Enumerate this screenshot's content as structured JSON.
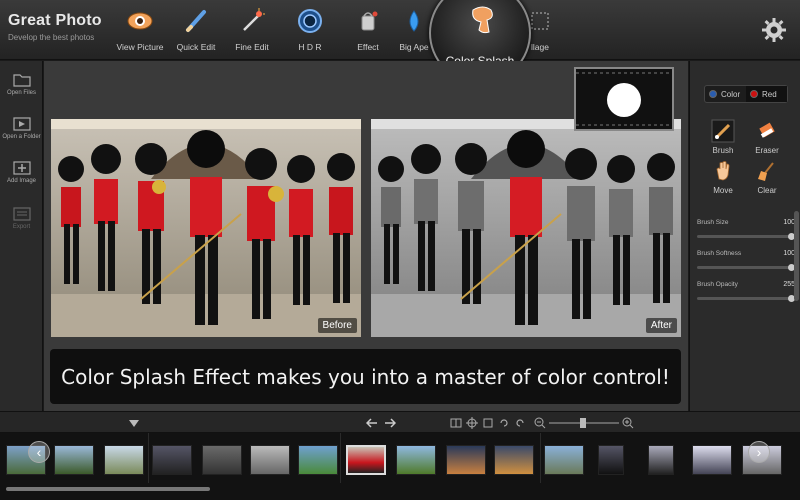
{
  "app": {
    "title": "Great Photo",
    "subtitle": "Develop the best photos"
  },
  "toolbar": {
    "items": [
      {
        "label": "View Picture",
        "icon": "eye-icon"
      },
      {
        "label": "Quick Edit",
        "icon": "pencil-icon"
      },
      {
        "label": "Fine Edit",
        "icon": "magic-wand-icon"
      },
      {
        "label": "H D R",
        "icon": "hdr-icon"
      },
      {
        "label": "Effect",
        "icon": "paint-bucket-icon"
      },
      {
        "label": "Big Aperture",
        "icon": "drop-icon"
      },
      {
        "label": "Color Splash",
        "icon": "color-splash-icon",
        "active": true
      },
      {
        "label": "Collage",
        "icon": "collage-icon"
      }
    ],
    "active_label": "Color Splash",
    "big_aperture_visible": "Big Ape",
    "collage_visible": "llage"
  },
  "sidebar": {
    "items": [
      {
        "label": "Open Files",
        "icon": "folder-icon"
      },
      {
        "label": "Open a Folder",
        "icon": "folder-open-icon"
      },
      {
        "label": "Add Image",
        "icon": "add-image-icon"
      },
      {
        "label": "Export",
        "icon": "export-icon",
        "disabled": true
      }
    ]
  },
  "canvas": {
    "before_label": "Before",
    "after_label": "After",
    "caption": "Color Splash Effect makes you into a master of color control!"
  },
  "right_panel": {
    "mode_options": [
      {
        "label": "Color",
        "color": "#2a5db0"
      },
      {
        "label": "Red",
        "color": "#cc1111",
        "selected": true
      }
    ],
    "tools": [
      {
        "label": "Brush",
        "icon": "brush-icon"
      },
      {
        "label": "Eraser",
        "icon": "eraser-icon"
      },
      {
        "label": "Move",
        "icon": "hand-icon"
      },
      {
        "label": "Clear",
        "icon": "broom-icon"
      }
    ],
    "sliders": [
      {
        "label": "Brush Size",
        "value": "100",
        "fraction": 1.0
      },
      {
        "label": "Brush Softness",
        "value": "100",
        "fraction": 1.0
      },
      {
        "label": "Brush Opacity",
        "value": "255",
        "fraction": 1.0
      }
    ]
  },
  "bottom_bar": {
    "icons": [
      "arrow-down-icon",
      "back-arrow-icon",
      "forward-arrow-icon",
      "compare-icon",
      "crop-icon",
      "fit-icon",
      "rotate-left-icon",
      "rotate-right-icon",
      "zoom-out-icon",
      "zoom-in-icon"
    ]
  },
  "filmstrip": {
    "thumb_count": 16,
    "active_index": 7
  },
  "colors": {
    "accent_red": "#cc1111",
    "background": "#1a1a1a",
    "canvas_bg": "#3a3a3a"
  }
}
